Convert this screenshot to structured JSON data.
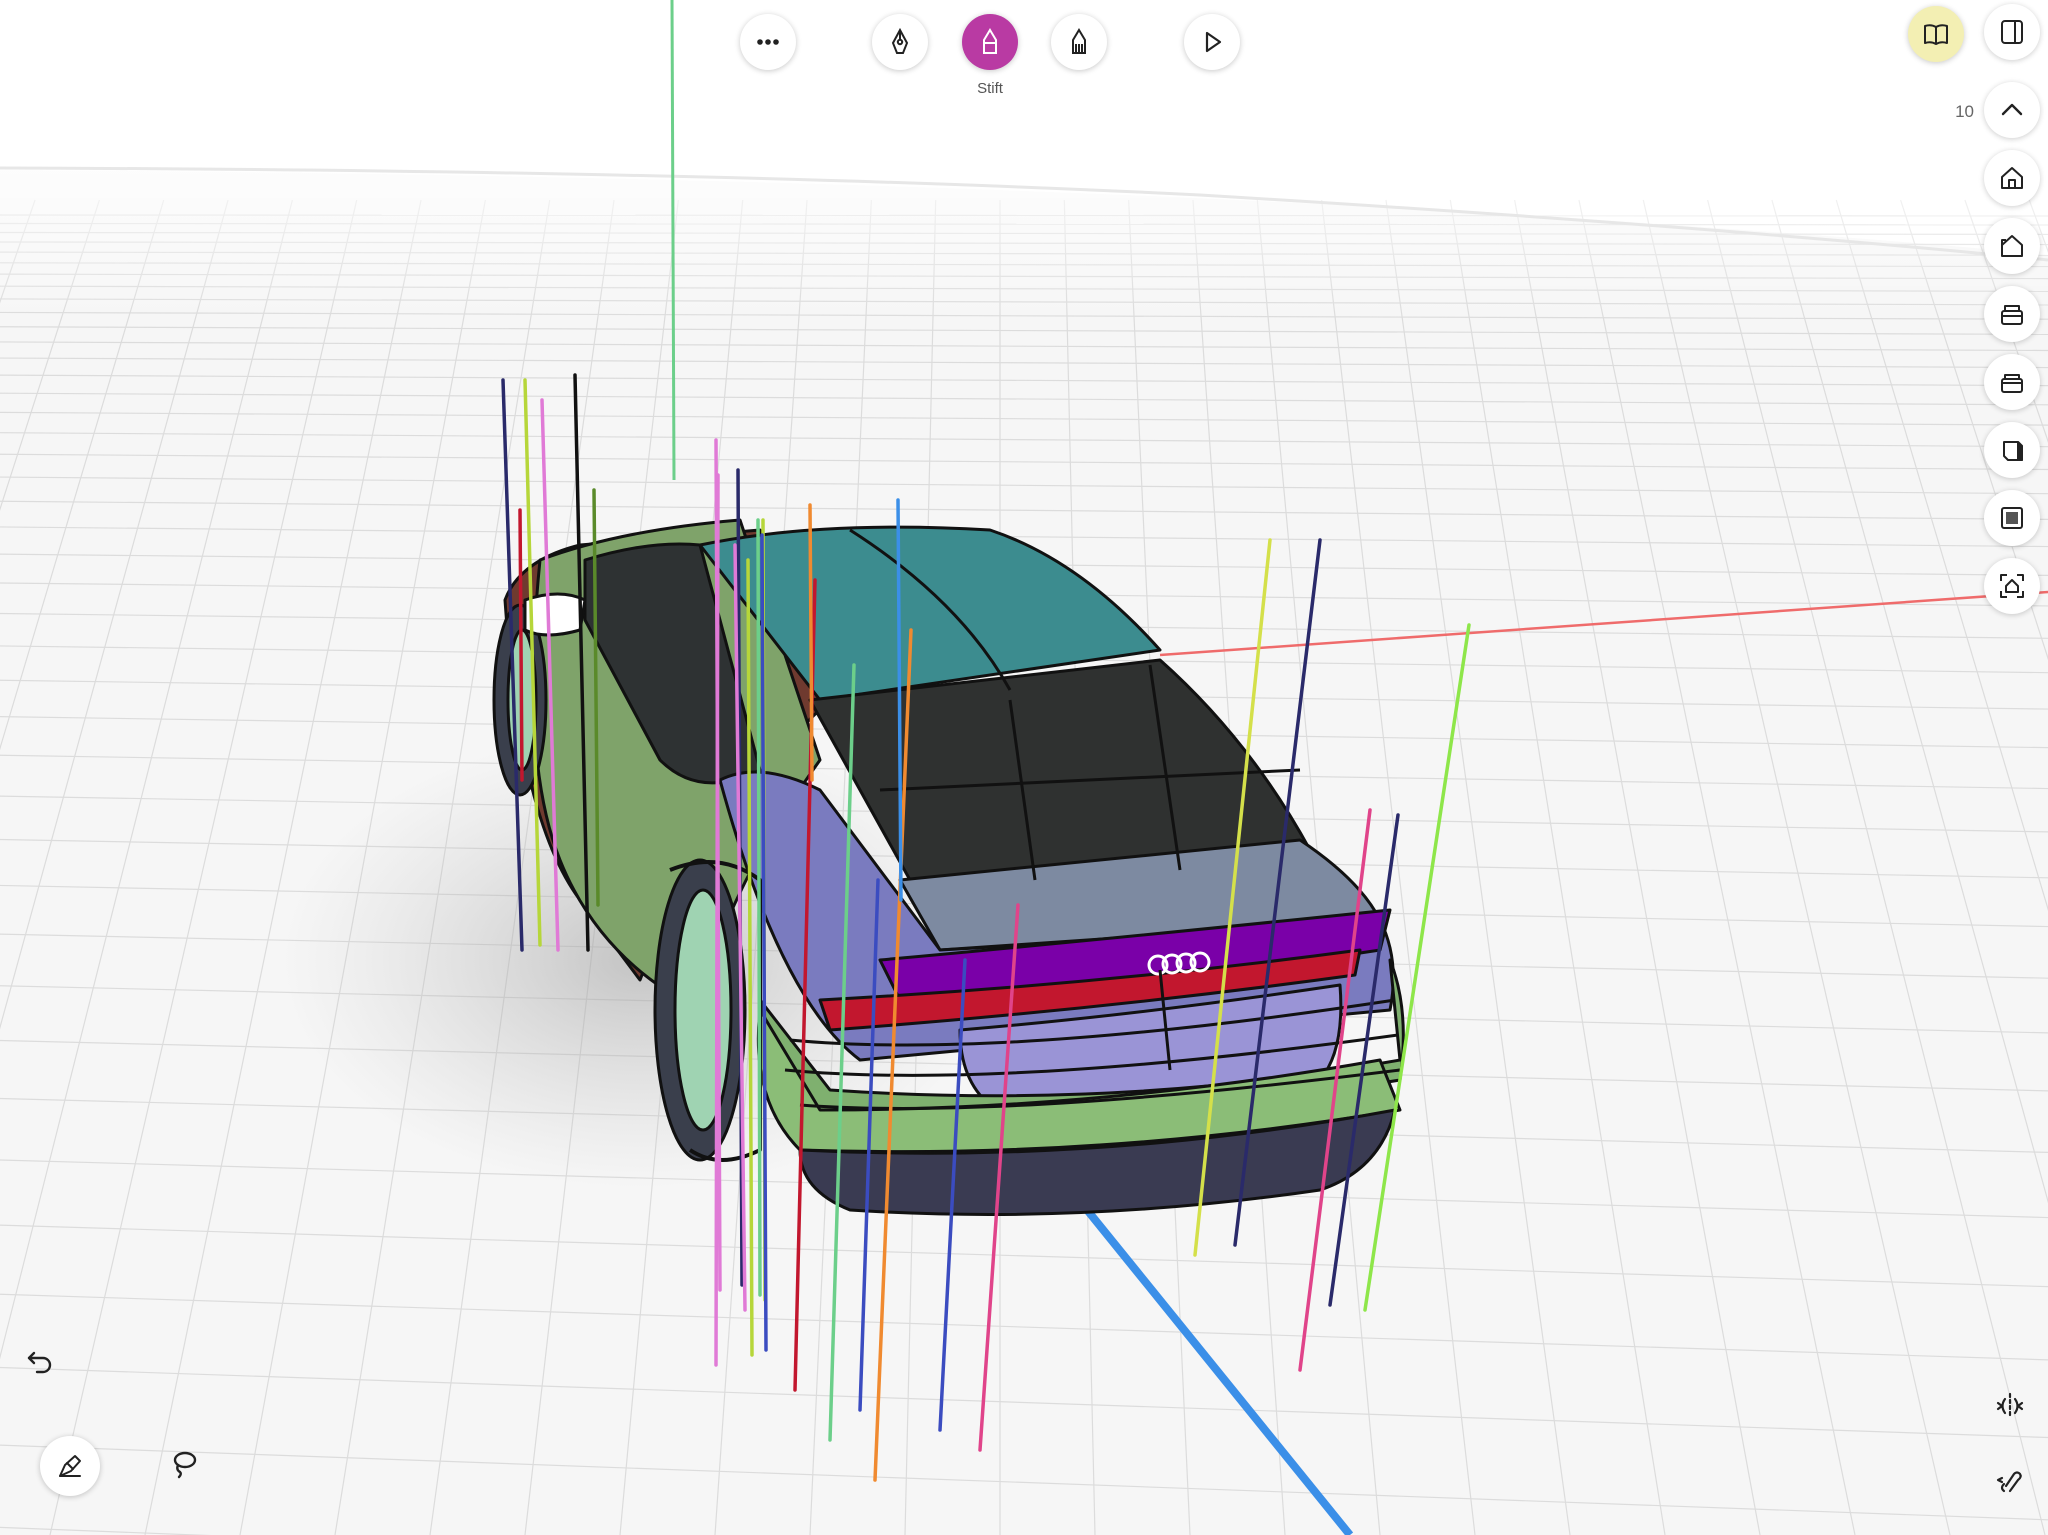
{
  "toolbar": {
    "more_icon": "more-horizontal-icon",
    "tools": [
      {
        "icon": "pen-nib-icon",
        "label": ""
      },
      {
        "icon": "marker-pen-icon",
        "label": "Stift",
        "active": true
      },
      {
        "icon": "brush-icon",
        "label": ""
      }
    ],
    "play_icon": "play-icon"
  },
  "top_right": {
    "book_icon": "book-open-icon",
    "panel_icon": "sidebar-panel-icon",
    "zoom_level": "10"
  },
  "view_buttons": [
    "chevron-up-icon",
    "home-view-icon",
    "home-corner-view-icon",
    "box-front-view-icon",
    "box-side-view-icon",
    "cube-half-icon",
    "cube-solid-icon",
    "frame-home-icon"
  ],
  "bottom_left": {
    "undo_icon": "undo-icon",
    "pencil_icon": "pencil-settings-icon",
    "lasso_icon": "lasso-icon"
  },
  "bottom_right": {
    "symmetry_icon": "symmetry-icon",
    "gesture_icon": "gesture-icon"
  },
  "colors": {
    "accent": "#b93aa3",
    "book_highlight": "#f3efb3",
    "x_axis": "#ef6b6b",
    "y_axis": "#6ccf8a",
    "z_axis": "#3b8fe8",
    "grid": "#dedede"
  },
  "model": {
    "brand_emblem": "four-rings-logo"
  }
}
